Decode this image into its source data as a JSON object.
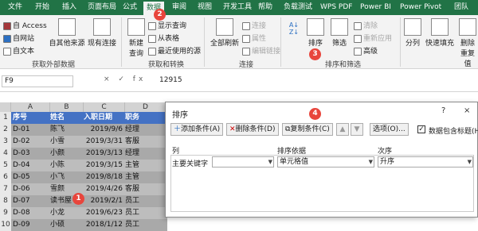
{
  "tabs": [
    "文件",
    "开始",
    "插入",
    "页面布局",
    "公式",
    "数据",
    "审阅",
    "视图",
    "开发工具",
    "帮助",
    "负载测试",
    "WPS PDF",
    "Power BI",
    "Power Pivot",
    "团队"
  ],
  "ribbon": {
    "get_external": {
      "access": "自 Access",
      "web": "自网站",
      "text": "自文本",
      "other": "自其他来源",
      "existing": "现有连接",
      "group": "获取外部数据"
    },
    "get_transform": {
      "new_query": "新建\n查询",
      "show_queries": "显示查询",
      "from_table": "从表格",
      "recent": "最近使用的源",
      "group": "获取和转换"
    },
    "connections": {
      "refresh_all": "全部刷新",
      "connections": "连接",
      "properties": "属性",
      "edit_links": "编辑链接",
      "group": "连接"
    },
    "sort_filter": {
      "sort": "排序",
      "filter": "筛选",
      "clear": "清除",
      "reapply": "重新应用",
      "advanced": "高级",
      "group": "排序和筛选"
    },
    "data_tools": {
      "split": "分列",
      "flash_fill": "快速填充",
      "remove_dup": "删除\n重复值"
    }
  },
  "formula_bar": {
    "name_box": "F9",
    "fx": "×  ✓  fx",
    "value": "12915"
  },
  "sheet": {
    "columns": [
      "A",
      "B",
      "C",
      "D"
    ],
    "header": [
      "序号",
      "姓名",
      "入职日期",
      "职务"
    ],
    "rows": [
      [
        "D-01",
        "陈飞",
        "2019/9/6",
        "经理"
      ],
      [
        "D-02",
        "小雪",
        "2019/3/31",
        "客服"
      ],
      [
        "D-03",
        "小颜",
        "2019/3/13",
        "经理"
      ],
      [
        "D-04",
        "小陈",
        "2019/3/15",
        "主管"
      ],
      [
        "D-05",
        "小飞",
        "2019/8/18",
        "主管"
      ],
      [
        "D-06",
        "雪颜",
        "2019/4/26",
        "客服"
      ],
      [
        "D-07",
        "读书屋",
        "2019/2/1",
        "员工"
      ],
      [
        "D-08",
        "小龙",
        "2019/6/23",
        "员工"
      ],
      [
        "D-09",
        "小硕",
        "2018/1/12",
        "员工"
      ]
    ],
    "row_numbers": [
      "1",
      "2",
      "3",
      "4",
      "5",
      "6",
      "7",
      "8",
      "9",
      "10"
    ]
  },
  "dialog": {
    "title": "排序",
    "help": "?",
    "close": "×",
    "add_level": "添加条件(A)",
    "delete_level": "删除条件(D)",
    "copy_level": "复制条件(C)",
    "up": "▲",
    "down": "▼",
    "options": "选项(O)...",
    "has_headers": "数据包含标题(H)",
    "col_header": "列",
    "sorton_header": "排序依据",
    "order_header": "次序",
    "row_label": "主要关键字",
    "column_value": "",
    "sorton_value": "单元格值",
    "order_value": "升序"
  },
  "badges": [
    "1",
    "2",
    "3",
    "4"
  ],
  "colors": {
    "excel_green": "#217346",
    "badge_red": "#e8453c",
    "row_select": "#a9a9a9",
    "header_row": "#4472c4"
  }
}
